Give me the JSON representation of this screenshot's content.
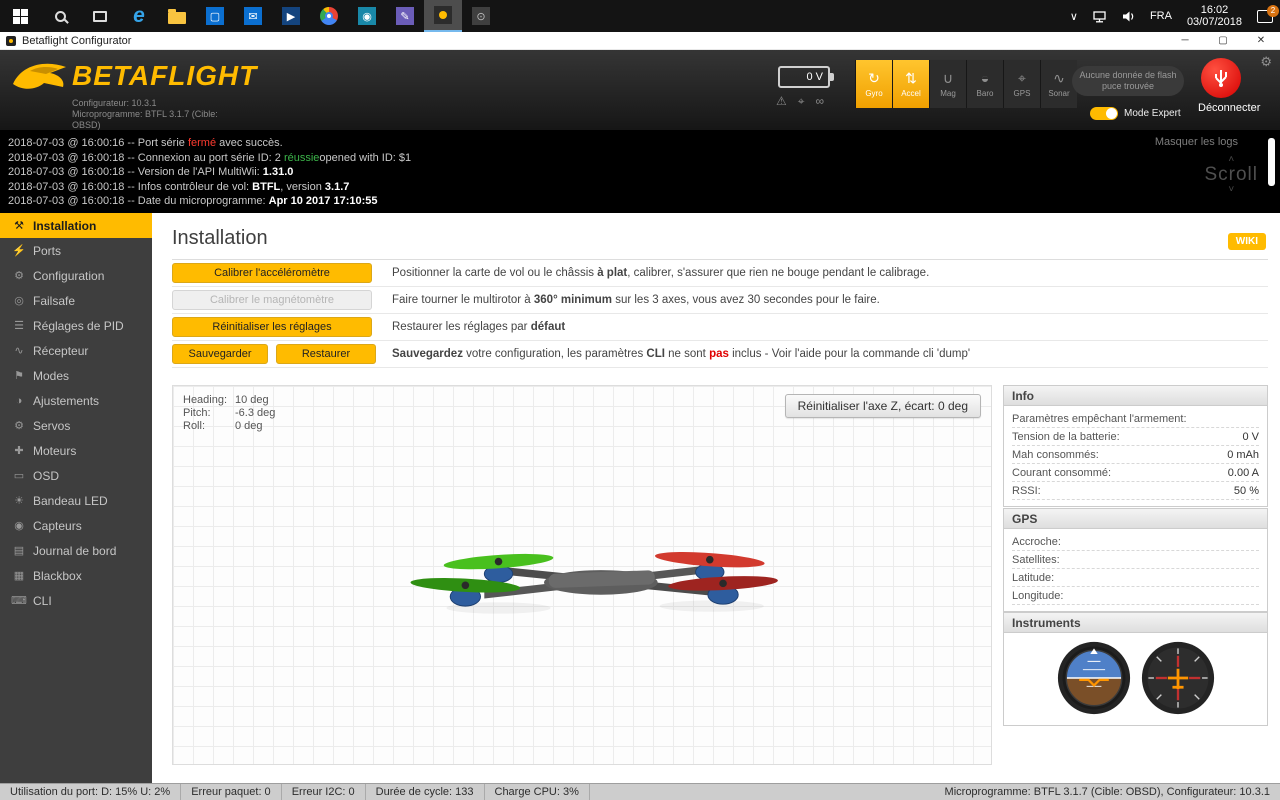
{
  "taskbar": {
    "time": "16:02",
    "date": "03/07/2018",
    "language": "FRA",
    "badge_count": "2"
  },
  "window": {
    "title": "Betaflight Configurator"
  },
  "header": {
    "logo_text": "BETAFLIGHT",
    "configurator_version": "Configurateur: 10.3.1",
    "firmware_line": "Microprogramme: BTFL 3.1.7 (Cible:",
    "firmware_target": "OBSD)",
    "battery_voltage": "0 V",
    "sensors": [
      {
        "label": "Gyro",
        "active": true
      },
      {
        "label": "Accel",
        "active": true
      },
      {
        "label": "Mag",
        "active": false
      },
      {
        "label": "Baro",
        "active": false
      },
      {
        "label": "GPS",
        "active": false
      },
      {
        "label": "Sonar",
        "active": false
      }
    ],
    "flash_button_line1": "Aucune donnée de flash",
    "flash_button_line2": "puce trouvée",
    "expert_mode_label": "Mode Expert",
    "disconnect_label": "Déconnecter"
  },
  "log": {
    "hide_label": "Masquer les logs",
    "scroll_label": "Scroll",
    "entries": [
      {
        "parts": [
          {
            "t": "2018-07-03 @ 16:00:16 -- Port série ",
            "s": "n"
          },
          {
            "t": "fermé",
            "s": "red"
          },
          {
            "t": " avec succès.",
            "s": "n"
          }
        ]
      },
      {
        "parts": [
          {
            "t": "2018-07-03 @ 16:00:18 -- Connexion au port série ID: 2 ",
            "s": "n"
          },
          {
            "t": "réussie",
            "s": "green"
          },
          {
            "t": "opened with ID: $1",
            "s": "n"
          }
        ]
      },
      {
        "parts": [
          {
            "t": "2018-07-03 @ 16:00:18 -- Version de l'API MultiWii: ",
            "s": "n"
          },
          {
            "t": "1.31.0",
            "s": "b"
          }
        ]
      },
      {
        "parts": [
          {
            "t": "2018-07-03 @ 16:00:18 -- Infos contrôleur de vol: ",
            "s": "n"
          },
          {
            "t": "BTFL",
            "s": "b"
          },
          {
            "t": ", version ",
            "s": "n"
          },
          {
            "t": "3.1.7",
            "s": "b"
          }
        ]
      },
      {
        "parts": [
          {
            "t": "2018-07-03 @ 16:00:18 -- Date du microprogramme: ",
            "s": "n"
          },
          {
            "t": "Apr 10 2017 17:10:55",
            "s": "b"
          }
        ]
      }
    ]
  },
  "sidebar": {
    "items": [
      {
        "label": "Installation",
        "active": true
      },
      {
        "label": "Ports"
      },
      {
        "label": "Configuration"
      },
      {
        "label": "Failsafe"
      },
      {
        "label": "Réglages de PID"
      },
      {
        "label": "Récepteur"
      },
      {
        "label": "Modes"
      },
      {
        "label": "Ajustements"
      },
      {
        "label": "Servos"
      },
      {
        "label": "Moteurs"
      },
      {
        "label": "OSD"
      },
      {
        "label": "Bandeau LED"
      },
      {
        "label": "Capteurs"
      },
      {
        "label": "Journal de bord"
      },
      {
        "label": "Blackbox"
      },
      {
        "label": "CLI"
      }
    ]
  },
  "setup": {
    "title": "Installation",
    "wiki_label": "WIKI",
    "calibrate_accel_button": "Calibrer l'accéléromètre",
    "accel_desc": [
      {
        "t": "Positionner la carte de vol ou le châssis ",
        "s": "n"
      },
      {
        "t": "à plat",
        "s": "b"
      },
      {
        "t": ", calibrer, s'assurer que rien ne bouge pendant le calibrage.",
        "s": "n"
      }
    ],
    "calibrate_mag_button": "Calibrer le magnétomètre",
    "mag_button_enabled": false,
    "mag_desc": [
      {
        "t": "Faire tourner le multirotor à ",
        "s": "n"
      },
      {
        "t": "360° minimum",
        "s": "b"
      },
      {
        "t": " sur les 3 axes, vous avez 30 secondes pour le faire.",
        "s": "n"
      }
    ],
    "reset_button": "Réinitialiser les réglages",
    "reset_desc": [
      {
        "t": "Restaurer les réglages par ",
        "s": "n"
      },
      {
        "t": "défaut",
        "s": "b"
      }
    ],
    "save_button": "Sauvegarder",
    "restore_button": "Restaurer",
    "save_desc": [
      {
        "t": "Sauvegardez",
        "s": "b"
      },
      {
        "t": " votre configuration, les paramètres ",
        "s": "n"
      },
      {
        "t": "CLI",
        "s": "b"
      },
      {
        "t": " ne sont ",
        "s": "n"
      },
      {
        "t": "pas",
        "s": "red"
      },
      {
        "t": " inclus - Voir l'aide pour la commande cli 'dump'",
        "s": "n"
      }
    ]
  },
  "model": {
    "heading_label": "Heading:",
    "heading_value": "10 deg",
    "pitch_label": "Pitch:",
    "pitch_value": "-6.3 deg",
    "roll_label": "Roll:",
    "roll_value": "0 deg",
    "reset_z_button": "Réinitialiser l'axe Z, écart: 0 deg"
  },
  "info_box": {
    "title": "Info",
    "arming_label": "Paramètres empêchant l'armement:",
    "rows": [
      {
        "label": "Tension de la batterie:",
        "value": "0 V"
      },
      {
        "label": "Mah consommés:",
        "value": "0 mAh"
      },
      {
        "label": "Courant consommé:",
        "value": "0.00 A"
      },
      {
        "label": "RSSI:",
        "value": "50 %"
      }
    ]
  },
  "gps_box": {
    "title": "GPS",
    "rows": [
      {
        "label": "Accroche:",
        "value": ""
      },
      {
        "label": "Satellites:",
        "value": ""
      },
      {
        "label": "Latitude:",
        "value": ""
      },
      {
        "label": "Longitude:",
        "value": ""
      }
    ]
  },
  "instruments_box": {
    "title": "Instruments"
  },
  "statusbar": {
    "port_usage": "Utilisation du port: D: 15% U: 2%",
    "packet_error": "Erreur paquet: 0",
    "i2c_error": "Erreur I2C: 0",
    "cycle_time": "Durée de cycle: 133",
    "cpu_load": "Charge CPU: 3%",
    "version_info": "Microprogramme: BTFL 3.1.7 (Cible: OBSD), Configurateur: 10.3.1"
  },
  "colors": {
    "accent": "#ffbb00",
    "disconnect_red": "#d40000"
  }
}
